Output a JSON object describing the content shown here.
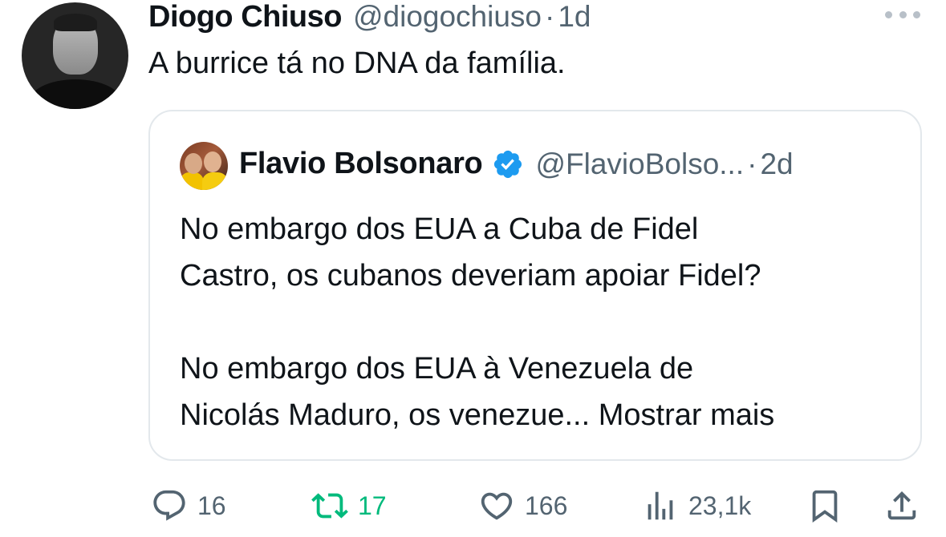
{
  "tweet": {
    "author_name": "Diogo Chiuso",
    "author_handle": "@diogochiuso",
    "separator": "·",
    "time": "1d",
    "text": "A burrice tá no DNA da família."
  },
  "quoted_tweet": {
    "author_name": "Flavio Bolsonaro",
    "verified": true,
    "author_handle": "@FlavioBolso...",
    "separator": "·",
    "time": "2d",
    "paragraph_1_line_1": "No embargo dos EUA a Cuba de Fidel",
    "paragraph_1_line_2": "Castro, os cubanos deveriam apoiar Fidel?",
    "paragraph_2_line_1": "No embargo dos EUA à Venezuela de",
    "paragraph_2_line_2": "Nicolás Maduro, os venezue...",
    "show_more": "Mostrar mais"
  },
  "actions": {
    "replies": "16",
    "retweets": "17",
    "likes": "166",
    "views": "23,1k"
  },
  "colors": {
    "text": "#0f1419",
    "secondary": "#536471",
    "retweet_active": "#00ba7c",
    "verified_badge": "#1d9bf0",
    "border": "#e3e8ec"
  },
  "icons": [
    "more-icon",
    "verified-icon",
    "reply-icon",
    "retweet-icon",
    "like-icon",
    "views-icon",
    "bookmark-icon",
    "share-icon"
  ]
}
